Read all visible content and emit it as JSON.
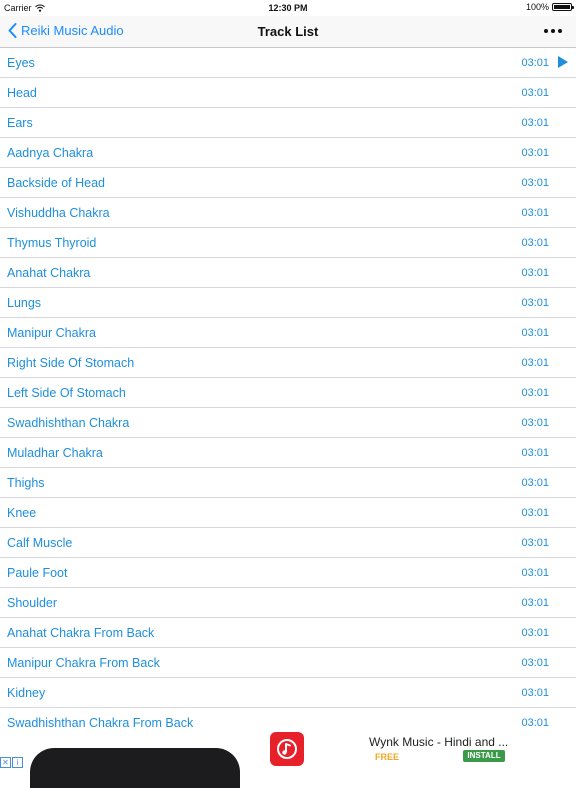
{
  "status_bar": {
    "carrier": "Carrier",
    "time": "12:30 PM",
    "battery": "100%",
    "battery_level": 1.0,
    "icons": [
      "wifi-icon",
      "battery-icon"
    ]
  },
  "nav_bar": {
    "back_label": "Reiki Music Audio",
    "title": "Track List",
    "icons": [
      "chevron-left-icon",
      "more-icon"
    ]
  },
  "colors": {
    "accent": "#1e8fdc",
    "nav_back": "#1a8cff",
    "separator": "#d8d8dc",
    "ad_icon": "#e8202a",
    "install_button": "#3a9a4a",
    "free_label": "#f5a623"
  },
  "tracks": [
    {
      "title": "Eyes",
      "duration": "03:01",
      "playing": true
    },
    {
      "title": "Head",
      "duration": "03:01"
    },
    {
      "title": "Ears",
      "duration": "03:01"
    },
    {
      "title": "Aadnya Chakra",
      "duration": "03:01"
    },
    {
      "title": "Backside of Head",
      "duration": "03:01"
    },
    {
      "title": "Vishuddha Chakra",
      "duration": "03:01"
    },
    {
      "title": "Thymus Thyroid",
      "duration": "03:01"
    },
    {
      "title": "Anahat Chakra",
      "duration": "03:01"
    },
    {
      "title": "Lungs",
      "duration": "03:01"
    },
    {
      "title": "Manipur Chakra",
      "duration": "03:01"
    },
    {
      "title": "Right Side Of Stomach",
      "duration": "03:01"
    },
    {
      "title": "Left Side Of Stomach",
      "duration": "03:01"
    },
    {
      "title": "Swadhishthan Chakra",
      "duration": "03:01"
    },
    {
      "title": "Muladhar Chakra",
      "duration": "03:01"
    },
    {
      "title": "Thighs",
      "duration": "03:01"
    },
    {
      "title": "Knee",
      "duration": "03:01"
    },
    {
      "title": "Calf Muscle",
      "duration": "03:01"
    },
    {
      "title": "Paule Foot",
      "duration": "03:01"
    },
    {
      "title": "Shoulder",
      "duration": "03:01"
    },
    {
      "title": "Anahat Chakra From Back",
      "duration": "03:01"
    },
    {
      "title": "Manipur Chakra From Back",
      "duration": "03:01"
    },
    {
      "title": "Kidney",
      "duration": "03:01"
    },
    {
      "title": "Swadhishthan Chakra From Back",
      "duration": "03:01"
    }
  ],
  "ad": {
    "app_name": "Wynk Music - Hindi and ...",
    "price": "FREE",
    "install_label": "INSTALL",
    "icons": [
      "music-note-icon",
      "ad-close-icon",
      "ad-info-icon"
    ]
  }
}
